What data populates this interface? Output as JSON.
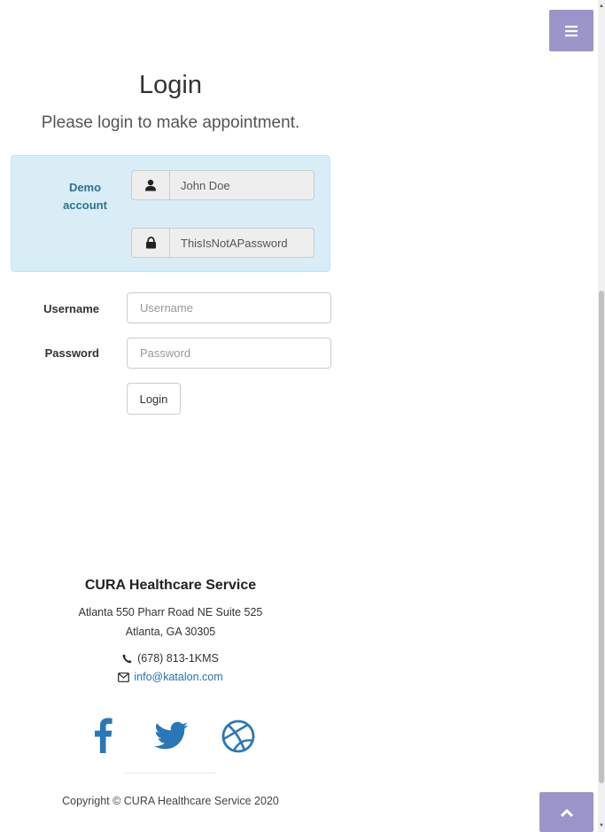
{
  "header": {
    "title": "Login",
    "subtitle": "Please login to make appointment."
  },
  "demo": {
    "label": "Demo account",
    "username": "John Doe",
    "password": "ThisIsNotAPassword"
  },
  "form": {
    "username_label": "Username",
    "username_placeholder": "Username",
    "username_value": "",
    "password_label": "Password",
    "password_placeholder": "Password",
    "password_value": "",
    "login_label": "Login"
  },
  "footer": {
    "title": "CURA Healthcare Service",
    "address_line1": "Atlanta 550 Pharr Road NE Suite 525",
    "address_line2": "Atlanta, GA 30305",
    "phone": "(678) 813-1KMS",
    "email": "info@katalon.com",
    "copyright": "Copyright © CURA Healthcare Service 2020"
  },
  "icons": {
    "menu": "hamburger-icon",
    "user": "user-icon",
    "lock": "lock-icon",
    "phone": "phone-icon",
    "email": "envelope-icon",
    "facebook": "facebook-icon",
    "twitter": "twitter-icon",
    "dribbble": "dribbble-icon",
    "to_top": "chevron-up-icon"
  },
  "colors": {
    "accent": "#9b95c9",
    "social": "#2a77b8",
    "demo_bg": "#d9edf7",
    "demo_text": "#31708f"
  }
}
